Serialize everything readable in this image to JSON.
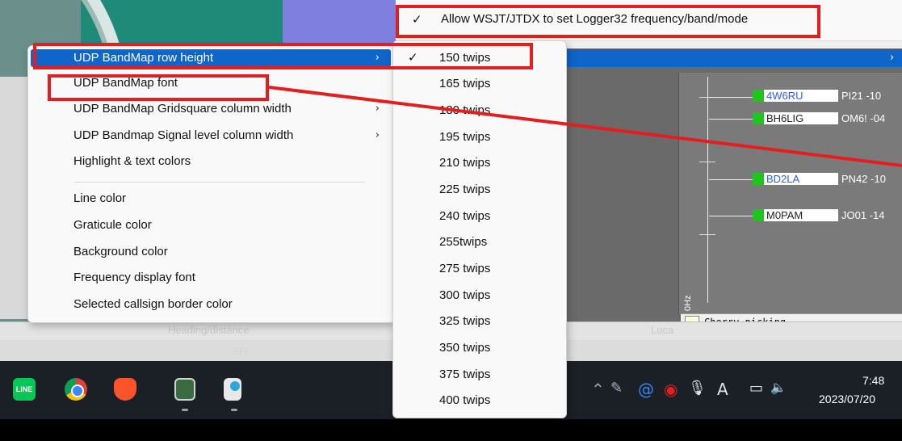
{
  "allow_option": {
    "label": "Allow WSJT/JTDX to set Logger32 frequency/band/mode",
    "checked": true
  },
  "main_menu": {
    "items": [
      {
        "label": "UDP BandMap row height",
        "has_submenu": true,
        "highlighted": true
      },
      {
        "label": "UDP BandMap font",
        "has_submenu": false
      },
      {
        "label": "UDP BandMap Gridsquare column width",
        "has_submenu": true
      },
      {
        "label": "UDP Bandmap Signal level column width",
        "has_submenu": true
      },
      {
        "label": "Highlight & text colors",
        "has_submenu": false
      },
      {
        "label": "Line color",
        "has_submenu": false
      },
      {
        "label": "Graticule color",
        "has_submenu": false
      },
      {
        "label": "Background color",
        "has_submenu": false
      },
      {
        "label": "Frequency display font",
        "has_submenu": false
      },
      {
        "label": "Selected callsign border color",
        "has_submenu": false
      }
    ],
    "chevron": "›"
  },
  "row_height_submenu": {
    "selected": "150 twips",
    "items": [
      "150 twips",
      "165 twips",
      "180 twips",
      "195 twips",
      "210 twips",
      "225 twips",
      "240 twips",
      "255twips",
      "275 twips",
      "300 twips",
      "325 twips",
      "350 twips",
      "375 twips",
      "400 twips"
    ]
  },
  "bandmap": {
    "spots": [
      {
        "call": "4W6RU",
        "grid": "PI21 -10"
      },
      {
        "call": "BH6LIG",
        "grid": "OM6! -04"
      },
      {
        "call": "BD2LA",
        "grid": "PN42 -10"
      },
      {
        "call": "M0PAM",
        "grid": "JO01 -14"
      }
    ],
    "hz_label": "0Hz",
    "cherry_picking": "Cherry-picking"
  },
  "status": {
    "heading": "Heading/distance",
    "loc": "Loca",
    "sfi": "SFI"
  },
  "taskbar": {
    "apps": [
      "line-app-icon",
      "chrome-icon",
      "brave-icon",
      "logger-app-icon",
      "search-tool-icon"
    ],
    "line_label": "LINE",
    "tray_input": "A",
    "time": "7:48",
    "date": "2023/07/20"
  },
  "colors": {
    "highlight": "#0f65c9",
    "annotation": "#e41e1e",
    "spot_green": "#1fc41f"
  }
}
